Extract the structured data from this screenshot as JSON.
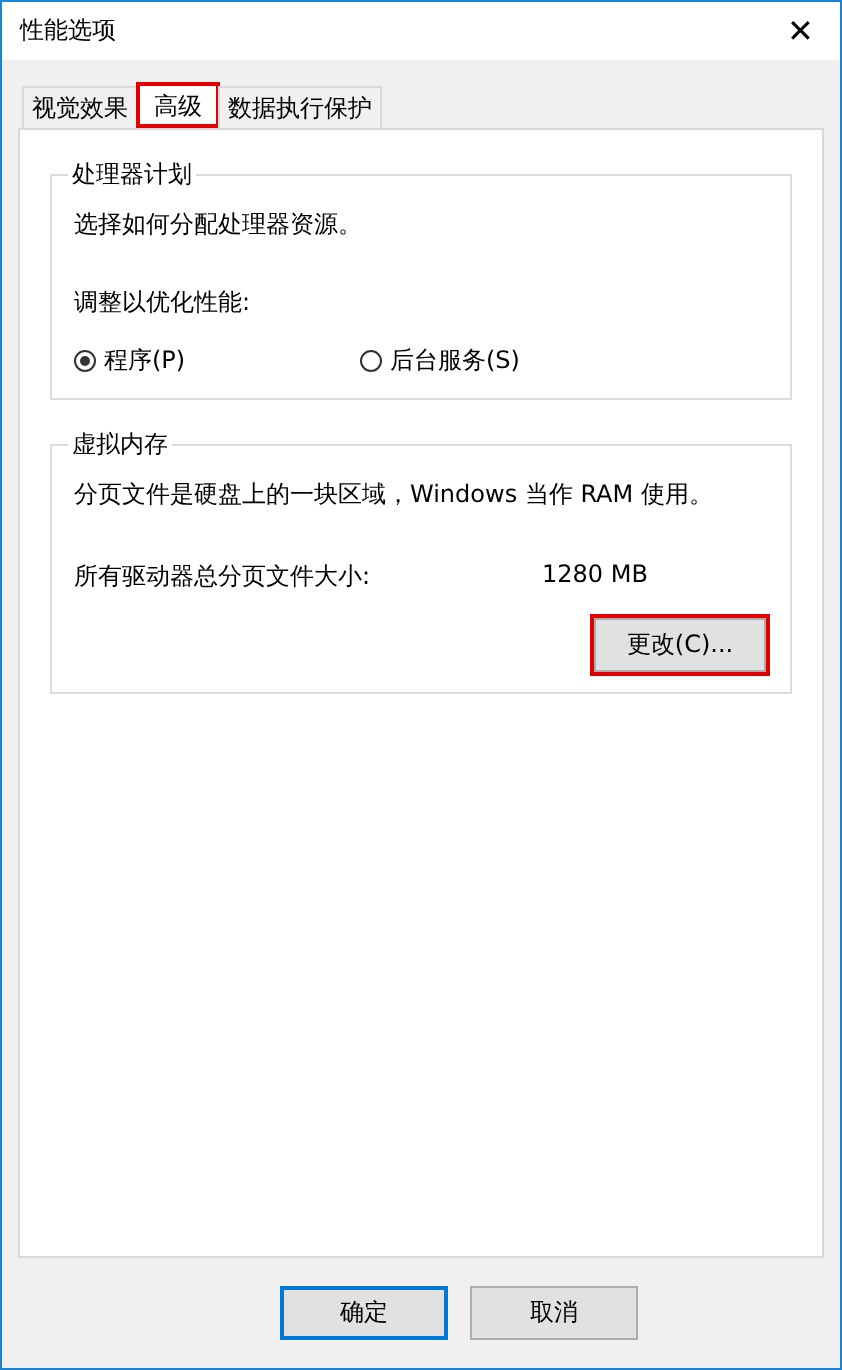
{
  "window": {
    "title": "性能选项",
    "close": "✕"
  },
  "tabs": [
    {
      "label": "视觉效果",
      "selected": false,
      "highlighted": false
    },
    {
      "label": "高级",
      "selected": true,
      "highlighted": true
    },
    {
      "label": "数据执行保护",
      "selected": false,
      "highlighted": false
    }
  ],
  "processor": {
    "title": "处理器计划",
    "description": "选择如何分配处理器资源。",
    "adjust_label": "调整以优化性能:",
    "options": [
      {
        "label": "程序(P)",
        "selected": true
      },
      {
        "label": "后台服务(S)",
        "selected": false
      }
    ]
  },
  "virtual_memory": {
    "title": "虚拟内存",
    "description": "分页文件是硬盘上的一块区域，Windows 当作 RAM 使用。",
    "size_label": "所有驱动器总分页文件大小:",
    "size_value": "1280 MB",
    "button": {
      "label": "更改(C)...",
      "highlighted": true
    }
  },
  "buttons": [
    {
      "label": "确定",
      "default": true
    },
    {
      "label": "取消",
      "default": false
    }
  ]
}
